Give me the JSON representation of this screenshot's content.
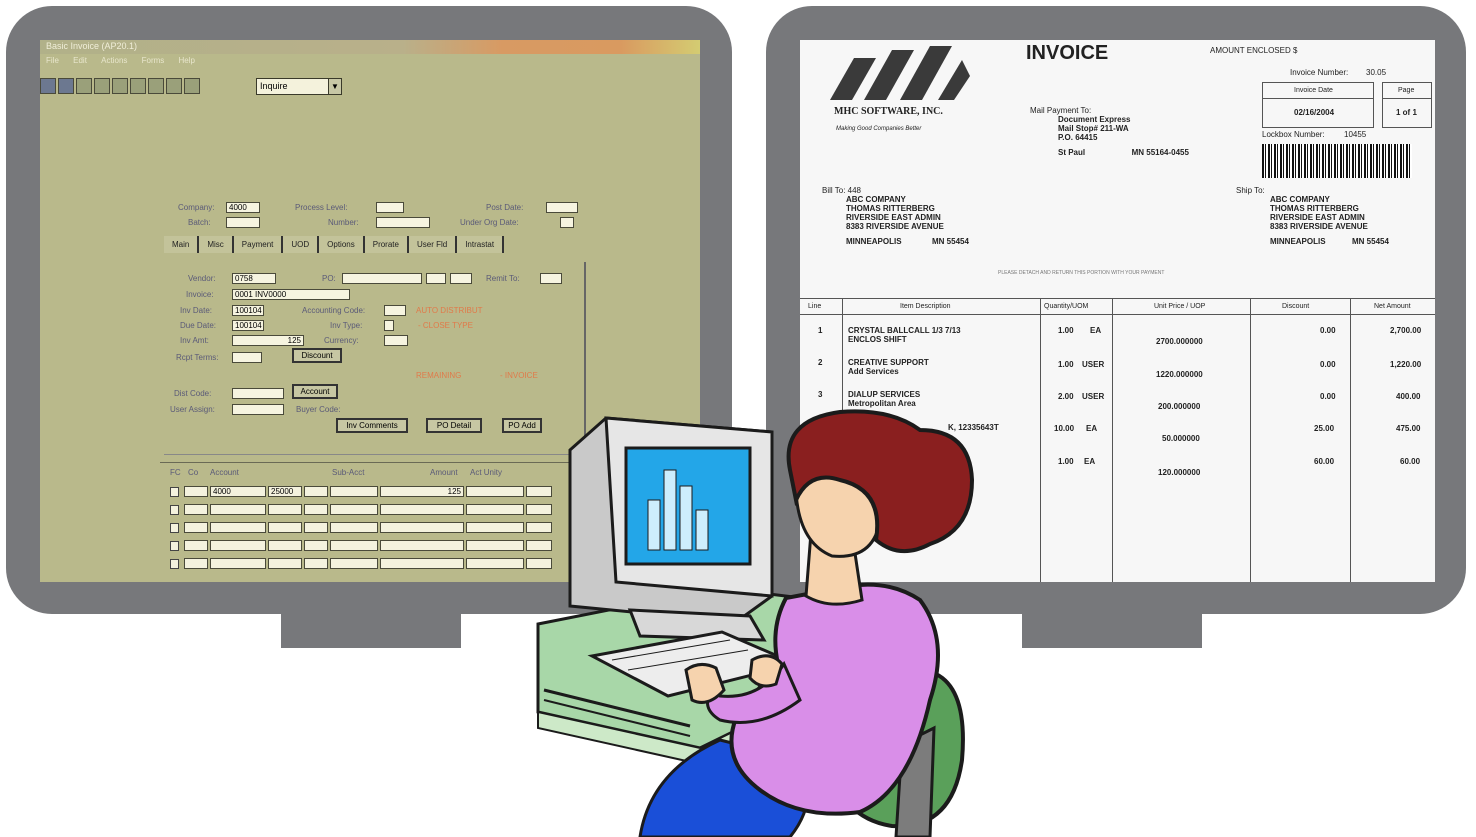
{
  "left_app": {
    "title": "Basic Invoice (AP20.1)",
    "menu": [
      "File",
      "Edit",
      "Actions",
      "Forms",
      "Help"
    ],
    "combo_value": "Inquire",
    "header_fields": {
      "company_label": "Company:",
      "company_value": "4000",
      "batch_label": "Batch:",
      "process_level_label": "Process Level:",
      "number_label": "Number:",
      "post_date_label": "Post Date:",
      "under_org_label": "Under Org Date:"
    },
    "tabs": [
      "Main",
      "Misc",
      "Payment",
      "UOD",
      "Options",
      "Prorate",
      "User Fld",
      "Intrastat"
    ],
    "main": {
      "vendor_label": "Vendor:",
      "vendor_value": "0758",
      "po_label": "PO:",
      "remit_to_label": "Remit To:",
      "invoice_label": "Invoice:",
      "invoice_value": "0001 INV0000",
      "inv_date_label": "Inv Date:",
      "inv_date_value": "100104",
      "due_date_label": "Due Date:",
      "due_date_value": "100104",
      "inv_amt_label": "Inv Amt:",
      "inv_amt_value": "125",
      "rec_terms_label": "Rcpt Terms:",
      "discount_button": "Discount",
      "accounting_code_label": "Accounting Code:",
      "inv_type_label": "Inv Type:",
      "currency_label": "Currency:",
      "dist_code_label": "Dist Code:",
      "account_button": "Account",
      "user_assign_label": "User Assign:",
      "buyer_code_label": "Buyer Code:",
      "comments_button": "Inv Comments",
      "po_detail_button": "PO Detail",
      "po_add_button": "PO Add",
      "orange_notes": [
        "AUTO DISTRIBUT",
        "- CLOSE TYPE",
        "REMAINING",
        "- INVOICE"
      ]
    },
    "grid": {
      "headers": [
        "FC",
        "Co",
        "Account",
        "",
        "",
        "Sub-Acct",
        "Amount",
        "Act Unity"
      ],
      "first_row": [
        "4000",
        "25000",
        "",
        "",
        "",
        "125"
      ]
    }
  },
  "invoice": {
    "title": "INVOICE",
    "amount_enclosed": "AMOUNT ENCLOSED $",
    "invoice_number_label": "Invoice Number:",
    "invoice_number_value": "30.05",
    "invoice_date_label": "Invoice Date",
    "page_label": "Page",
    "invoice_date_value": "02/16/2004",
    "page_value": "1 of 1",
    "lockbox_label": "Lockbox Number:",
    "lockbox_value": "10455",
    "company_name": "MHC SOFTWARE, INC.",
    "tagline": "Making Good Companies Better",
    "mail_payment": [
      "Mail Payment To:",
      "Document Express",
      "Mail Stop# 211-WA",
      "P.O. 64415",
      "St Paul",
      "MN 55164-0455"
    ],
    "bill_to": [
      "Bill To: 448",
      "ABC COMPANY",
      "THOMAS RITTERBERG",
      "RIVERSIDE EAST ADMIN",
      "8383 RIVERSIDE AVENUE",
      "MINNEAPOLIS",
      "MN 55454"
    ],
    "ship_to": [
      "Ship To:",
      "ABC COMPANY",
      "THOMAS RITTERBERG",
      "RIVERSIDE EAST ADMIN",
      "8383 RIVERSIDE AVENUE",
      "MINNEAPOLIS",
      "MN 55454"
    ],
    "separator_note": "PLEASE DETACH AND RETURN THIS PORTION WITH YOUR PAYMENT",
    "columns": [
      "Line",
      "Item Description",
      "Quantity/UOM",
      "Unit Price / UOP",
      "Discount",
      "Net Amount"
    ],
    "rows": [
      {
        "line": "1",
        "desc": "CRYSTAL BALLCALL 1/3 7/13",
        "desc2": "ENCLOS SHIFT",
        "qty": "1.00",
        "uom": "EA",
        "price": "2700.000000",
        "discount": "0.00",
        "net": "2,700.00"
      },
      {
        "line": "2",
        "desc": "CREATIVE SUPPORT",
        "desc2": "Add Services",
        "qty": "1.00",
        "uom": "USER",
        "price": "1220.000000",
        "discount": "0.00",
        "net": "1,220.00"
      },
      {
        "line": "3",
        "desc": "DIALUP SERVICES",
        "desc2": "Metropolitan Area",
        "qty": "2.00",
        "uom": "USER",
        "price": "200.000000",
        "discount": "0.00",
        "net": "400.00"
      },
      {
        "line": "",
        "desc": "K, 12335643T",
        "desc2": "",
        "qty": "10.00",
        "uom": "EA",
        "price": "50.000000",
        "discount": "25.00",
        "net": "475.00"
      },
      {
        "line": "",
        "desc": "",
        "desc2": "",
        "qty": "1.00",
        "uom": "EA",
        "price": "120.000000",
        "discount": "60.00",
        "net": "60.00"
      }
    ]
  },
  "colors": {
    "monitor_frame": "#77787b",
    "app_background": "#b9b98b",
    "shirt": "#d98ee8",
    "hair": "#8a1f1f",
    "chart_screen": "#23a6e8",
    "desk": "#a8d7a8",
    "chair": "#5aa05a"
  }
}
